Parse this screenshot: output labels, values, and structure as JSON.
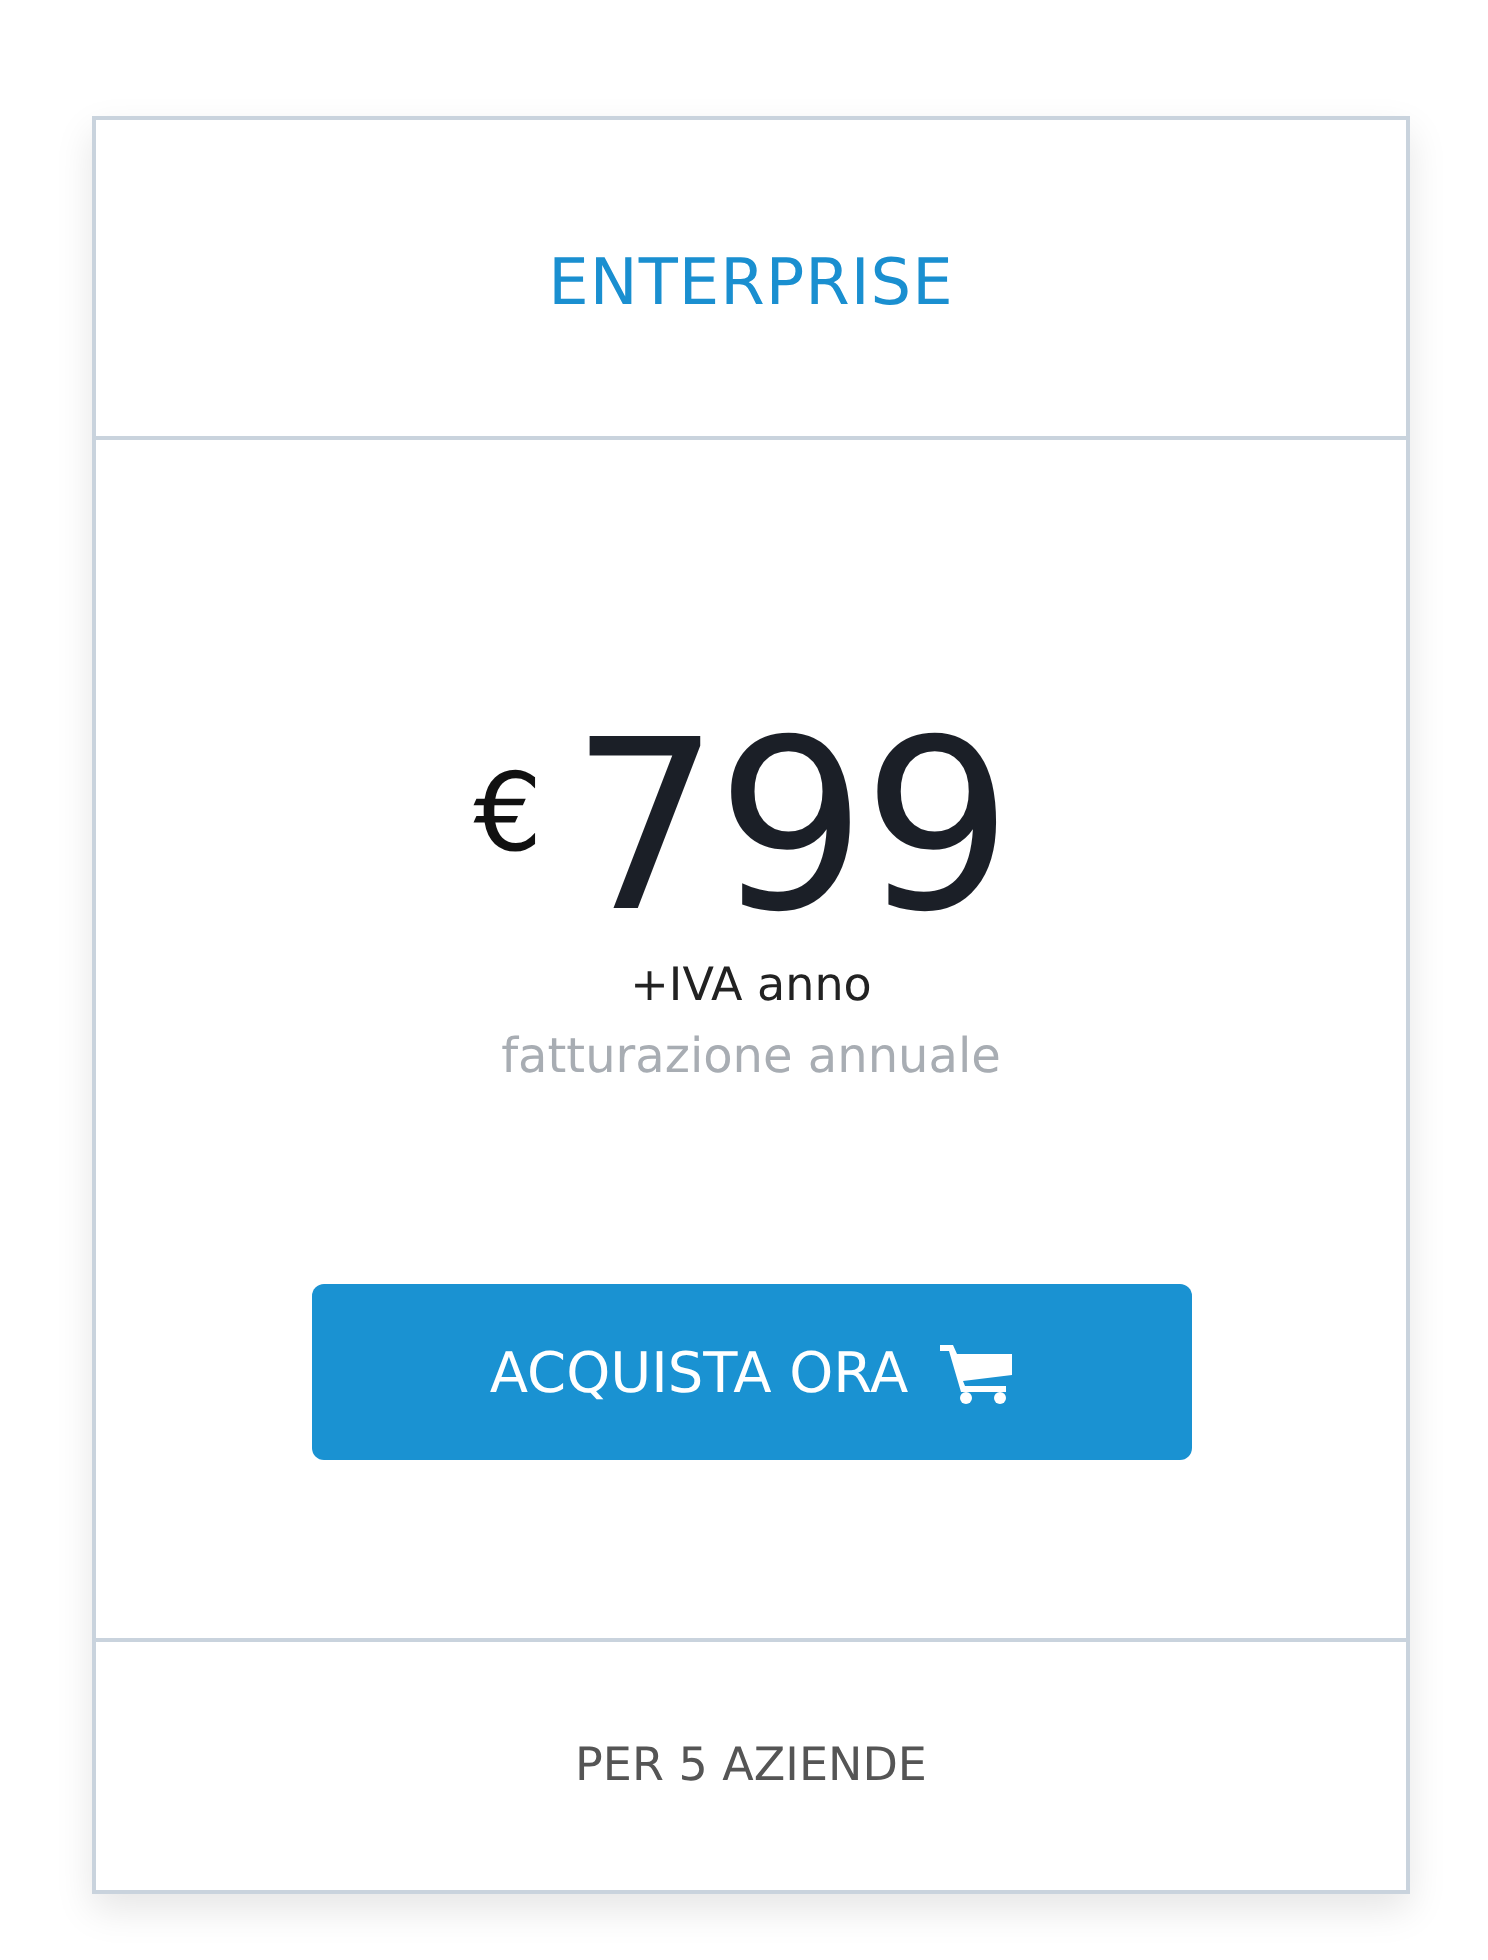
{
  "plan": {
    "title": "ENTERPRISE"
  },
  "price": {
    "currency": "€",
    "amount": "799",
    "suffix": "+IVA anno",
    "note": "fatturazione annuale"
  },
  "button": {
    "label": "ACQUISTA ORA"
  },
  "footer": {
    "text": "PER 5 AZIENDE"
  }
}
